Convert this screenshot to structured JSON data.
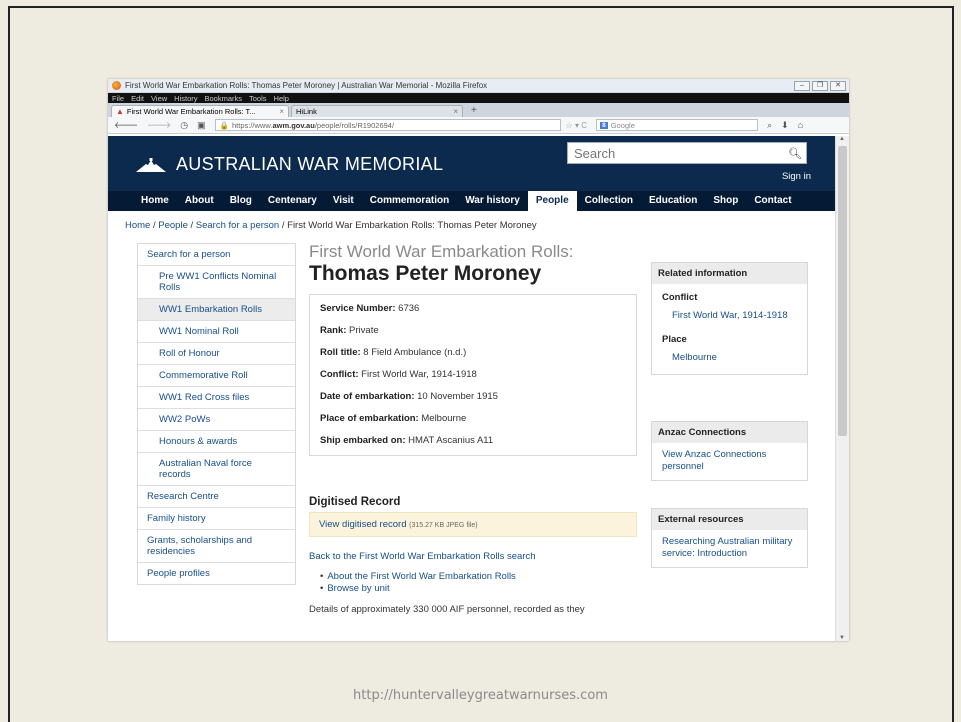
{
  "browser": {
    "window_title": "First World War Embarkation Rolls: Thomas Peter Moroney | Australian War Memorial - Mozilla Firefox",
    "menu": [
      "File",
      "Edit",
      "View",
      "History",
      "Bookmarks",
      "Tools",
      "Help"
    ],
    "tabs": [
      {
        "label": "First World War Embarkation Rolls: T..."
      },
      {
        "label": "HiLink"
      }
    ],
    "url_prefix": "https://www.",
    "url_domain": "awm.gov.au",
    "url_path": "/people/rolls/R1902694/",
    "search_engine_placeholder": "Google"
  },
  "site": {
    "logo_text": "AUSTRALIAN WAR MEMORIAL",
    "search_placeholder": "Search",
    "signin": "Sign in",
    "nav": [
      "Home",
      "About",
      "Blog",
      "Centenary",
      "Visit",
      "Commemoration",
      "War history",
      "People",
      "Collection",
      "Education",
      "Shop",
      "Contact"
    ],
    "nav_active": "People"
  },
  "breadcrumb": {
    "items": [
      "Home",
      "People",
      "Search for a person"
    ],
    "current": "First World War Embarkation Rolls: Thomas Peter Moroney"
  },
  "sidebar": [
    {
      "label": "Search for a person"
    },
    {
      "label": "Pre WW1 Conflicts Nominal Rolls"
    },
    {
      "label": "WW1 Embarkation Rolls"
    },
    {
      "label": "WW1 Nominal Roll"
    },
    {
      "label": "Roll of Honour"
    },
    {
      "label": "Commemorative Roll"
    },
    {
      "label": "WW1 Red Cross files"
    },
    {
      "label": "WW2 PoWs"
    },
    {
      "label": "Honours & awards"
    },
    {
      "label": "Australian Naval force records"
    },
    {
      "label": "Research Centre"
    },
    {
      "label": "Family history"
    },
    {
      "label": "Grants, scholarships and residencies"
    },
    {
      "label": "People profiles"
    }
  ],
  "record": {
    "kicker": "First World War Embarkation Rolls:",
    "name": "Thomas Peter Moroney",
    "fields": [
      {
        "label": "Service Number:",
        "value": "6736"
      },
      {
        "label": "Rank:",
        "value": "Private"
      },
      {
        "label": "Roll title:",
        "value": "8 Field Ambulance (n.d.)"
      },
      {
        "label": "Conflict:",
        "value": "First World War, 1914-1918"
      },
      {
        "label": "Date of embarkation:",
        "value": "10 November 1915"
      },
      {
        "label": "Place of embarkation:",
        "value": "Melbourne"
      },
      {
        "label": "Ship embarked on:",
        "value": "HMAT Ascanius A11"
      }
    ],
    "digitised_heading": "Digitised Record",
    "digitised_link": "View digitised record",
    "digitised_meta": "(315.27 KB JPEG file)",
    "back_link": "Back to the First World War Embarkation Rolls search",
    "related_links": [
      "About the First World War Embarkation Rolls",
      "Browse by unit"
    ],
    "details_text": "Details of approximately 330 000 AIF personnel, recorded as they"
  },
  "related": {
    "heading": "Related information",
    "conflict_label": "Conflict",
    "conflict_link": "First World War, 1914-1918",
    "place_label": "Place",
    "place_link": "Melbourne"
  },
  "anzac": {
    "heading": "Anzac Connections",
    "link": "View Anzac Connections personnel"
  },
  "external": {
    "heading": "External resources",
    "link": "Researching Australian military service: Introduction"
  },
  "footer_url": "http://huntervalleygreatwarnurses.com"
}
